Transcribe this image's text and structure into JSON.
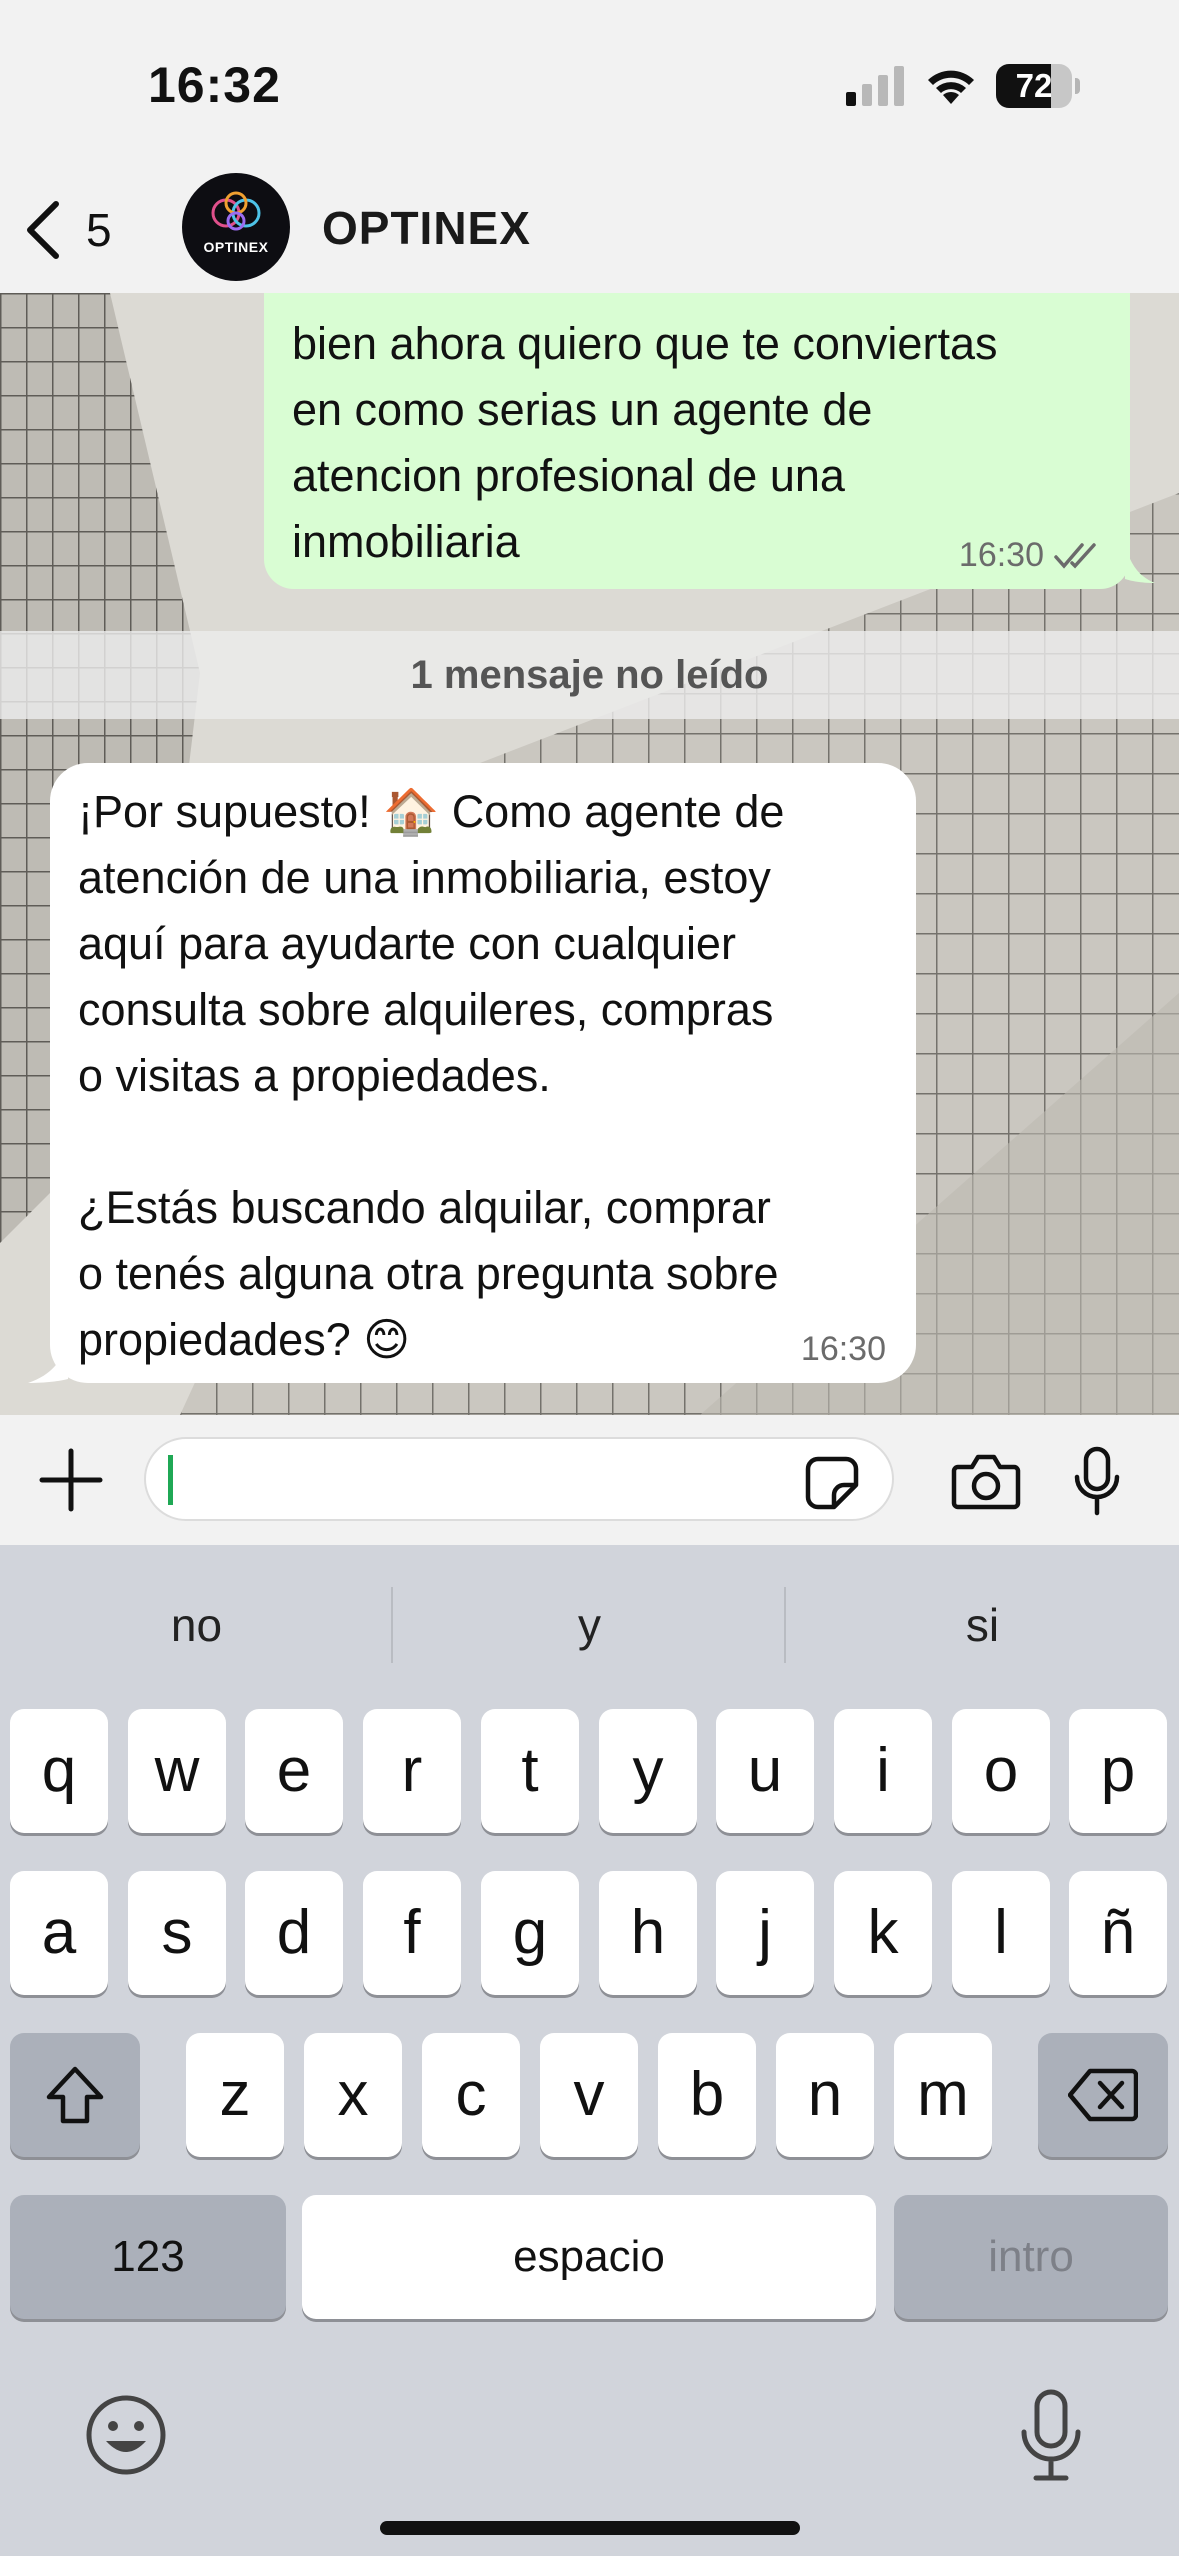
{
  "status_bar": {
    "time": "16:32",
    "battery_level": "72",
    "battery_fraction": 0.72,
    "signal_icon": "cellular-signal-icon",
    "wifi_icon": "wifi-icon"
  },
  "header": {
    "back_count": "5",
    "back_icon": "chevron-left-icon",
    "contact_name": "OPTINEX",
    "avatar_text": "OPTINEX"
  },
  "messages": [
    {
      "direction": "outgoing",
      "text": "bien ahora quiero que te conviertas\nen como serias un agente de\natencion profesional de una\ninmobiliaria",
      "time": "16:30",
      "status_icon": "double-check-icon",
      "bubble_color": "#d9fdd3"
    },
    {
      "direction": "incoming",
      "text": "¡Por supuesto! 🏠 Como agente de\natención de una inmobiliaria, estoy\naquí para ayudarte con cualquier\nconsulta sobre alquileres, compras\no visitas a propiedades.\n\n¿Estás buscando alquilar, comprar\no tenés alguna otra pregunta sobre\npropiedades? 😊",
      "time": "16:30",
      "bubble_color": "#ffffff"
    }
  ],
  "unread_banner": "1 mensaje no leído",
  "input_bar": {
    "value": "",
    "plus_icon": "plus-icon",
    "sticker_icon": "sticker-icon",
    "camera_icon": "camera-icon",
    "mic_icon": "microphone-icon",
    "accent_color": "#1fa855"
  },
  "keyboard": {
    "suggestions": [
      "no",
      "y",
      "si"
    ],
    "row1": [
      "q",
      "w",
      "e",
      "r",
      "t",
      "y",
      "u",
      "i",
      "o",
      "p"
    ],
    "row2": [
      "a",
      "s",
      "d",
      "f",
      "g",
      "h",
      "j",
      "k",
      "l",
      "ñ"
    ],
    "row3": [
      "z",
      "x",
      "c",
      "v",
      "b",
      "n",
      "m"
    ],
    "numbers_label": "123",
    "space_label": "espacio",
    "return_label": "intro",
    "shift_icon": "shift-icon",
    "delete_icon": "backspace-icon",
    "emoji_icon": "emoji-icon",
    "dictation_icon": "dictation-mic-icon"
  }
}
